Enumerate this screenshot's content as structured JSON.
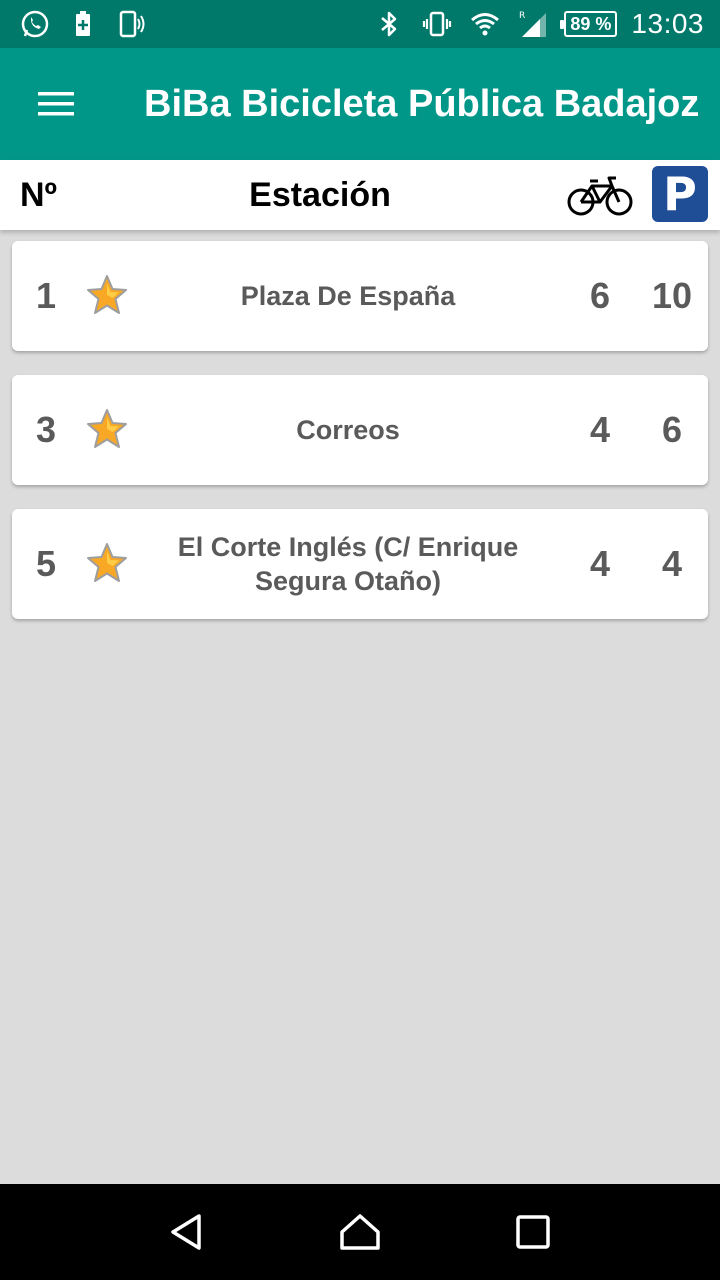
{
  "status_bar": {
    "left_icons": [
      "whatsapp-icon",
      "battery-saver-icon",
      "phone-signal-icon"
    ],
    "right_icons": [
      "bluetooth-icon",
      "vibrate-icon",
      "wifi-icon",
      "cell-signal-icon"
    ],
    "battery": "89 %",
    "time": "13:03"
  },
  "app_bar": {
    "title": "BiBa Bicicleta Pública Badajoz"
  },
  "table_header": {
    "number_label": "Nº",
    "station_label": "Estación",
    "parking_label": "P"
  },
  "stations": [
    {
      "number": "1",
      "name": "Plaza De España",
      "bikes": "6",
      "slots": "10"
    },
    {
      "number": "3",
      "name": "Correos",
      "bikes": "4",
      "slots": "6"
    },
    {
      "number": "5",
      "name": "El Corte Inglés (C/ Enrique Segura Otaño)",
      "bikes": "4",
      "slots": "4"
    }
  ],
  "colors": {
    "status_bar": "#00796b",
    "app_bar": "#009688",
    "parking_badge": "#1f4e96",
    "star": "#f9a825",
    "background": "#dcdcdc"
  }
}
